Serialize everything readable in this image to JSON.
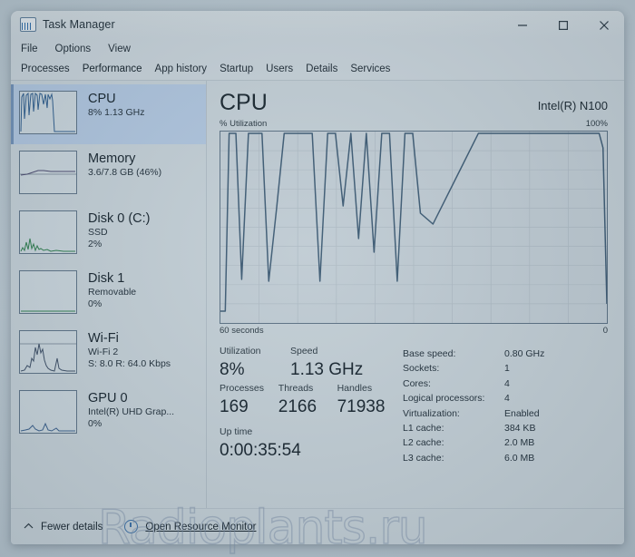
{
  "window": {
    "title": "Task Manager",
    "icon": "task-manager-icon",
    "controls": {
      "minimize": "─",
      "maximize": "□",
      "close": "✕"
    }
  },
  "menu": [
    "File",
    "Options",
    "View"
  ],
  "tabs": [
    {
      "label": "Processes",
      "active": false
    },
    {
      "label": "Performance",
      "active": true
    },
    {
      "label": "App history",
      "active": false
    },
    {
      "label": "Startup",
      "active": false
    },
    {
      "label": "Users",
      "active": false
    },
    {
      "label": "Details",
      "active": false
    },
    {
      "label": "Services",
      "active": false
    }
  ],
  "sidebar": {
    "items": [
      {
        "title": "CPU",
        "line1": "8% 1.13 GHz",
        "line2": "",
        "selected": true,
        "graph_color": "#2f5d8c"
      },
      {
        "title": "Memory",
        "line1": "3.6/7.8 GB (46%)",
        "line2": "",
        "selected": false,
        "graph_color": "#4a4a6e"
      },
      {
        "title": "Disk 0 (C:)",
        "line1": "SSD",
        "line2": "2%",
        "selected": false,
        "graph_color": "#2f7d4f"
      },
      {
        "title": "Disk 1",
        "line1": "Removable",
        "line2": "0%",
        "selected": false,
        "graph_color": "#2f7d4f"
      },
      {
        "title": "Wi-Fi",
        "line1": "Wi-Fi 2",
        "line2": "S: 8.0 R: 64.0 Kbps",
        "selected": false,
        "graph_color": "#3d4f66"
      },
      {
        "title": "GPU 0",
        "line1": "Intel(R) UHD Grap...",
        "line2": "0%",
        "selected": false,
        "graph_color": "#3a5f8a"
      }
    ]
  },
  "main": {
    "title": "CPU",
    "model": "Intel(R) N100",
    "axis_top_left": "% Utilization",
    "axis_top_right": "100%",
    "axis_bottom_left": "60 seconds",
    "axis_bottom_right": "0",
    "stats": {
      "utilization_label": "Utilization",
      "utilization_value": "8%",
      "speed_label": "Speed",
      "speed_value": "1.13 GHz",
      "processes_label": "Processes",
      "processes_value": "169",
      "threads_label": "Threads",
      "threads_value": "2166",
      "handles_label": "Handles",
      "handles_value": "71938",
      "uptime_label": "Up time",
      "uptime_value": "0:00:35:54"
    },
    "specs": [
      {
        "key": "Base speed:",
        "value": "0.80 GHz"
      },
      {
        "key": "Sockets:",
        "value": "1"
      },
      {
        "key": "Cores:",
        "value": "4"
      },
      {
        "key": "Logical processors:",
        "value": "4"
      },
      {
        "key": "Virtualization:",
        "value": "Enabled"
      },
      {
        "key": "L1 cache:",
        "value": "384 KB"
      },
      {
        "key": "L2 cache:",
        "value": "2.0 MB"
      },
      {
        "key": "L3 cache:",
        "value": "6.0 MB"
      }
    ]
  },
  "statusbar": {
    "fewer_details": "Fewer details",
    "resource_monitor": "Open Resource Monitor"
  },
  "watermark": {
    "text": "Radioplants.ru"
  },
  "colors": {
    "window_bg": "#c2ced5",
    "selection": "#aec4dd",
    "graph_line": "#3c5a73",
    "graph_bg": "#bfcbd3",
    "text": "#16242e"
  },
  "chart_data": {
    "type": "line",
    "title": "CPU",
    "xlabel": "60 seconds",
    "ylabel": "% Utilization",
    "ylim": [
      0,
      100
    ],
    "xlim": [
      60,
      0
    ],
    "grid": true,
    "legend": null,
    "x_tick_labels": [
      "60 seconds",
      "0"
    ],
    "y_tick_labels": [
      "100%",
      ""
    ],
    "series": [
      {
        "name": "CPU Utilization",
        "color": "#3c5a73",
        "x": [
          60.0,
          59.2,
          58.6,
          57.6,
          56.6,
          55.6,
          54.6,
          53.6,
          52.6,
          51.4,
          50.2,
          49.0,
          47.4,
          45.8,
          44.6,
          43.4,
          42.2,
          41.0,
          39.8,
          38.6,
          37.4,
          36.2,
          35.0,
          33.8,
          32.6,
          31.4,
          30.2,
          29.0,
          27.0,
          20.0,
          12.0,
          4.0,
          2.0,
          1.0,
          0.4,
          0.0
        ],
        "y": [
          6,
          6,
          100,
          100,
          23,
          100,
          100,
          100,
          22,
          60,
          100,
          100,
          100,
          100,
          22,
          100,
          100,
          62,
          100,
          45,
          100,
          38,
          100,
          100,
          22,
          100,
          100,
          58,
          52,
          100,
          100,
          100,
          100,
          100,
          92,
          10
        ]
      }
    ]
  }
}
